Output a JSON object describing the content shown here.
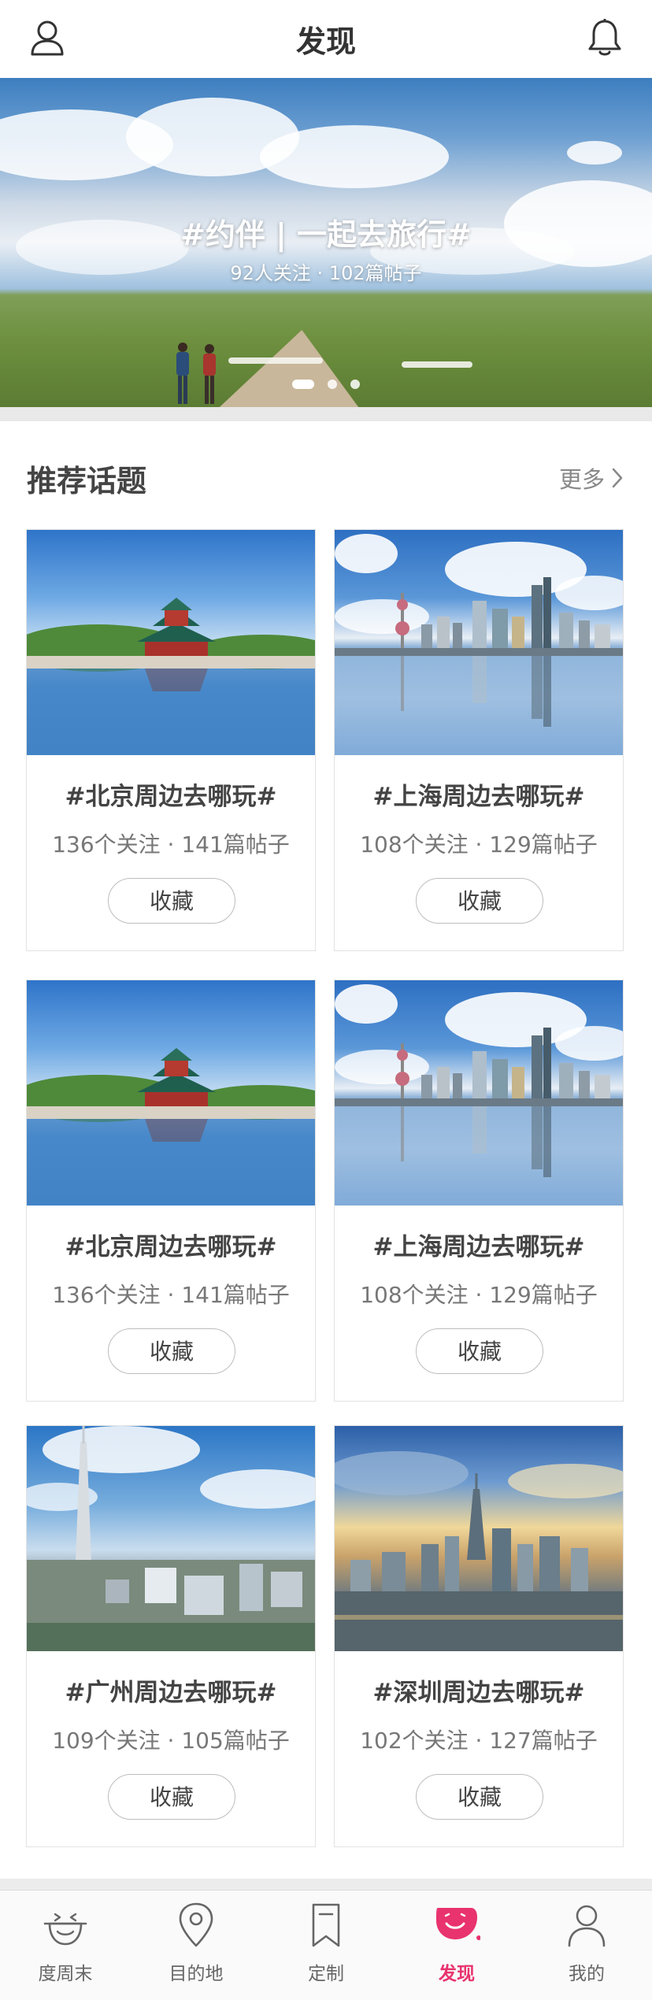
{
  "header": {
    "title": "发现",
    "left_icon": "user-icon",
    "right_icon": "bell-icon"
  },
  "banner": {
    "title": "#约伴 | 一起去旅行#",
    "subtitle": "92人关注 · 102篇帖子",
    "slide_count": 3,
    "active_slide": 1
  },
  "section": {
    "title": "推荐话题",
    "more_label": "更多"
  },
  "cards": [
    {
      "topic": "#北京周边去哪玩#",
      "stats": "136个关注 · 141篇帖子",
      "button": "收藏",
      "image": "beijing-turret"
    },
    {
      "topic": "#上海周边去哪玩#",
      "stats": "108个关注 · 129篇帖子",
      "button": "收藏",
      "image": "shanghai-skyline"
    },
    {
      "topic": "#北京周边去哪玩#",
      "stats": "136个关注 · 141篇帖子",
      "button": "收藏",
      "image": "beijing-turret"
    },
    {
      "topic": "#上海周边去哪玩#",
      "stats": "108个关注 · 129篇帖子",
      "button": "收藏",
      "image": "shanghai-skyline"
    },
    {
      "topic": "#广州周边去哪玩#",
      "stats": "109个关注 · 105篇帖子",
      "button": "收藏",
      "image": "guangzhou-tower"
    },
    {
      "topic": "#深圳周边去哪玩#",
      "stats": "102个关注 · 127篇帖子",
      "button": "收藏",
      "image": "shenzhen-skyline"
    }
  ],
  "tabs": [
    {
      "label": "度周末",
      "icon": "weekend-face-icon"
    },
    {
      "label": "目的地",
      "icon": "map-pin-icon"
    },
    {
      "label": "定制",
      "icon": "bookmark-icon"
    },
    {
      "label": "发现",
      "icon": "discover-smile-icon",
      "active": true
    },
    {
      "label": "我的",
      "icon": "profile-icon"
    }
  ],
  "colors": {
    "accent": "#e8336e",
    "text_primary": "#444444",
    "text_secondary": "#777777"
  }
}
